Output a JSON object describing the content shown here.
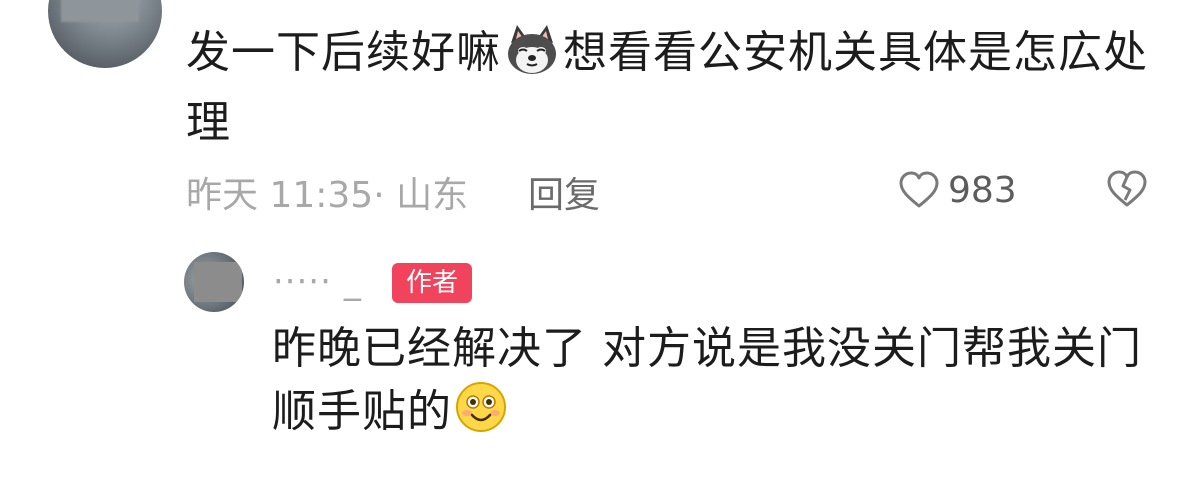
{
  "comment": {
    "text_before_emoji": "发一下后续好嘛",
    "emoji": "husky-dog-emoji",
    "text_after_emoji": "想看看公安机关具体是怎広处理",
    "time_location": "昨天 11:35· 山东",
    "reply_label": "回复",
    "like_count": "983"
  },
  "reply": {
    "author": "⋅⋅⋅⋅⋅ _",
    "author_tag": "作者",
    "text": "昨晚已经解决了  对方说是我没关门帮我关门顺手贴的",
    "emoji": "grinning-face-emoji"
  },
  "colors": {
    "tag_red": "#f1435b",
    "meta_gray": "#a8a8a8",
    "text_dark": "#1c1c1c"
  }
}
